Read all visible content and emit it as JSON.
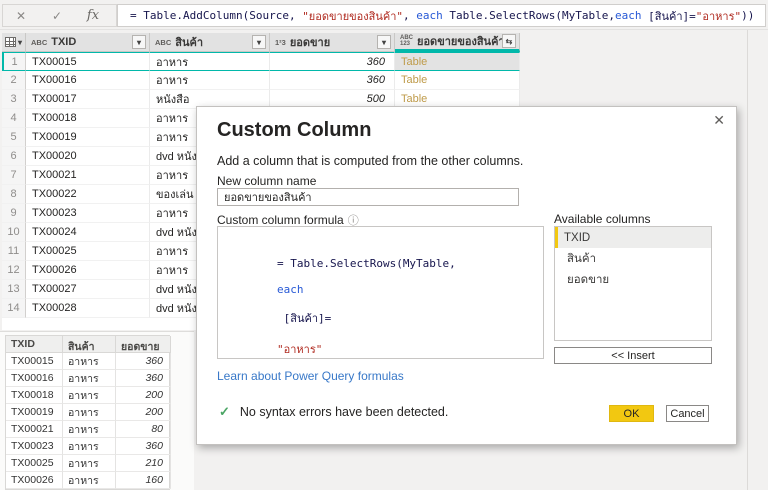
{
  "icons": {
    "cancel_entry": "✕",
    "commit_entry": "✓",
    "fx": "fx",
    "filter": "▾",
    "header_menu": "▾",
    "expand_column": "⇆",
    "dialog_close": "✕",
    "info": "ⓘ",
    "syntax_ok_check": "✓"
  },
  "colors": {
    "accent_teal": "#01b8aa",
    "accent_yellow": "#f2c811",
    "table_link": "#bf9b4a",
    "link_blue": "#3878c8",
    "keyword_blue": "#2759d6",
    "string_red": "#b02b20"
  },
  "formula_bar": {
    "segments": [
      {
        "t": "= Table.AddColumn(Source, ",
        "c": "code"
      },
      {
        "t": "\"ยอดขายของสินค้า\"",
        "c": "str"
      },
      {
        "t": ", ",
        "c": "code"
      },
      {
        "t": "each",
        "c": "kw"
      },
      {
        "t": " Table.SelectRows(MyTable,",
        "c": "code"
      },
      {
        "t": "each",
        "c": "kw"
      },
      {
        "t": " [สินค้า]=",
        "c": "code"
      },
      {
        "t": "\"อาหาร\"",
        "c": "str"
      },
      {
        "t": "))",
        "c": "code"
      }
    ]
  },
  "grid": {
    "columns": [
      {
        "icon": "ABC",
        "label": "TXID"
      },
      {
        "icon": "ABC",
        "label": "สินค้า"
      },
      {
        "icon": "1²3",
        "label": "ยอดขาย"
      },
      {
        "icon_top": "ABC",
        "icon_bottom": "123",
        "label": "ยอดขายของสินค้า"
      }
    ],
    "rows": [
      {
        "n": "1",
        "txid": "TX00015",
        "product": "อาหาร",
        "sales": "360",
        "table": "Table",
        "selected": true
      },
      {
        "n": "2",
        "txid": "TX00016",
        "product": "อาหาร",
        "sales": "360",
        "table": "Table"
      },
      {
        "n": "3",
        "txid": "TX00017",
        "product": "หนังสือ",
        "sales": "500",
        "table": "Table"
      },
      {
        "n": "4",
        "txid": "TX00018",
        "product": "อาหาร",
        "sales": "",
        "table": ""
      },
      {
        "n": "5",
        "txid": "TX00019",
        "product": "อาหาร",
        "sales": "",
        "table": ""
      },
      {
        "n": "6",
        "txid": "TX00020",
        "product": "dvd หนัง",
        "sales": "",
        "table": ""
      },
      {
        "n": "7",
        "txid": "TX00021",
        "product": "อาหาร",
        "sales": "",
        "table": ""
      },
      {
        "n": "8",
        "txid": "TX00022",
        "product": "ของเล่น",
        "sales": "",
        "table": ""
      },
      {
        "n": "9",
        "txid": "TX00023",
        "product": "อาหาร",
        "sales": "",
        "table": ""
      },
      {
        "n": "10",
        "txid": "TX00024",
        "product": "dvd หนัง",
        "sales": "",
        "table": ""
      },
      {
        "n": "11",
        "txid": "TX00025",
        "product": "อาหาร",
        "sales": "",
        "table": ""
      },
      {
        "n": "12",
        "txid": "TX00026",
        "product": "อาหาร",
        "sales": "",
        "table": ""
      },
      {
        "n": "13",
        "txid": "TX00027",
        "product": "dvd หนัง",
        "sales": "",
        "table": ""
      },
      {
        "n": "14",
        "txid": "TX00028",
        "product": "dvd หนัง",
        "sales": "",
        "table": ""
      }
    ]
  },
  "preview_table": {
    "headers": [
      "TXID",
      "สินค้า",
      "ยอดขาย"
    ],
    "rows": [
      {
        "txid": "TX00015",
        "product": "อาหาร",
        "sales": "360"
      },
      {
        "txid": "TX00016",
        "product": "อาหาร",
        "sales": "360"
      },
      {
        "txid": "TX00018",
        "product": "อาหาร",
        "sales": "200"
      },
      {
        "txid": "TX00019",
        "product": "อาหาร",
        "sales": "200"
      },
      {
        "txid": "TX00021",
        "product": "อาหาร",
        "sales": "80"
      },
      {
        "txid": "TX00023",
        "product": "อาหาร",
        "sales": "360"
      },
      {
        "txid": "TX00025",
        "product": "อาหาร",
        "sales": "210"
      },
      {
        "txid": "TX00026",
        "product": "อาหาร",
        "sales": "160"
      }
    ]
  },
  "dialog": {
    "title": "Custom Column",
    "description": "Add a column that is computed from the other columns.",
    "new_column_name_label": "New column name",
    "new_column_name_value": "ยอดขายของสินค้า",
    "formula_label": "Custom column formula",
    "formula_segments": [
      {
        "t": "= Table.SelectRows(MyTable,",
        "c": "code"
      },
      {
        "t": "each",
        "c": "kw"
      },
      {
        "t": " [สินค้า]=",
        "c": "code"
      },
      {
        "t": "\"อาหาร\"",
        "c": "str"
      },
      {
        "t": ")",
        "c": "code"
      }
    ],
    "available_columns_label": "Available columns",
    "available_columns": [
      {
        "label": "TXID",
        "selected": true
      },
      {
        "label": "สินค้า"
      },
      {
        "label": "ยอดขาย"
      }
    ],
    "insert_button": "<< Insert",
    "learn_link": "Learn about Power Query formulas",
    "status_message": "No syntax errors have been detected.",
    "ok_button": "OK",
    "cancel_button": "Cancel"
  }
}
